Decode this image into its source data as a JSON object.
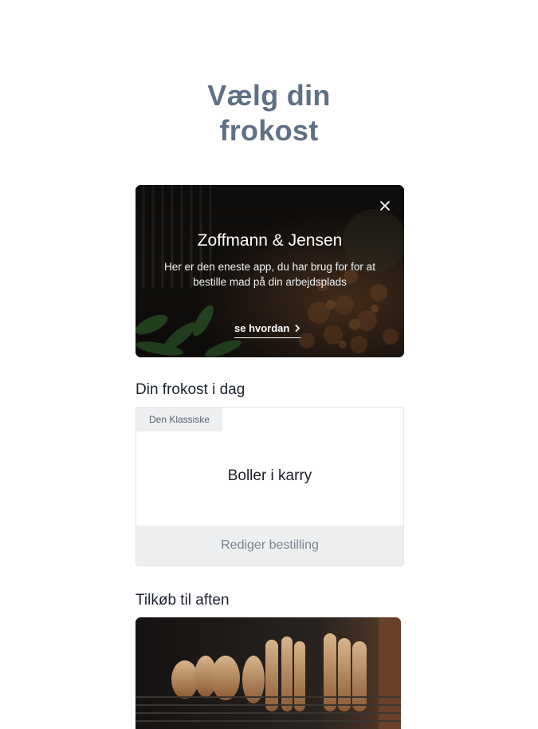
{
  "header": {
    "title_line1": "Vælg din",
    "title_line2": "frokost"
  },
  "promo": {
    "title": "Zoffmann & Jensen",
    "description": "Her er den eneste app, du har brug for for at bestille mad på din arbejdsplads",
    "cta_label": "se hvordan",
    "close_icon": "close-icon",
    "cta_icon": "chevron-right-icon"
  },
  "lunch": {
    "heading": "Din frokost i dag",
    "tag": "Den Klassiske",
    "dish": "Boller i karry",
    "edit_label": "Rediger bestilling"
  },
  "addons": {
    "heading": "Tilkøb til aften"
  },
  "colors": {
    "title": "#5e7085",
    "card_footer": "#eceef0",
    "heading_text": "#1c2330"
  }
}
